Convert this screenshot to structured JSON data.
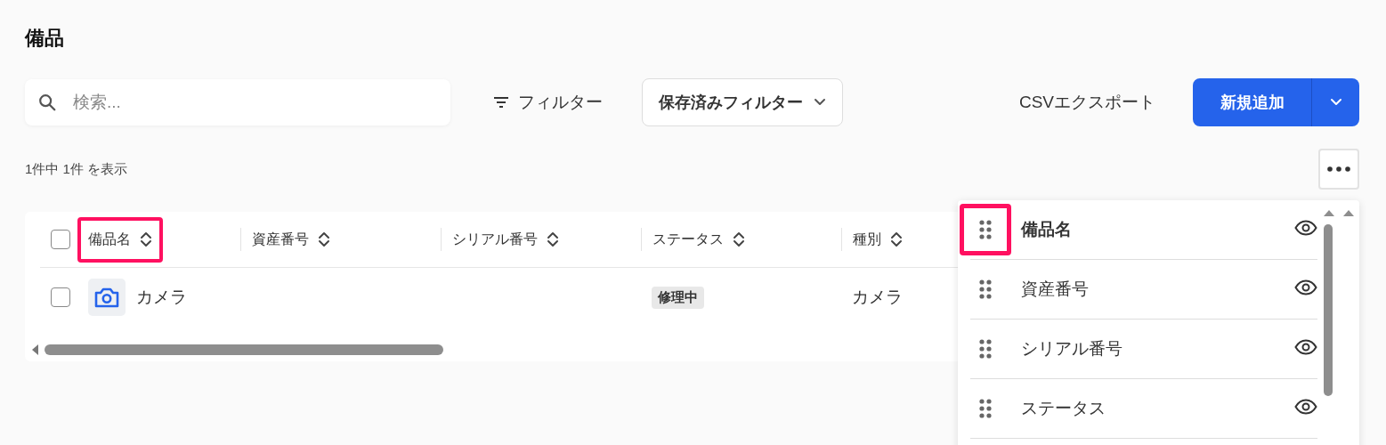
{
  "page": {
    "title": "備品"
  },
  "toolbar": {
    "search": {
      "placeholder": "検索..."
    },
    "filter_button": "フィルター",
    "saved_filters": "保存済みフィルター",
    "export_button": "CSVエクスポート",
    "add_button": "新規追加"
  },
  "result_count": "1件中 1件 を表示",
  "table": {
    "all_selected": false,
    "columns": [
      {
        "label": "備品名",
        "highlighted": true
      },
      {
        "label": "資産番号",
        "highlighted": false
      },
      {
        "label": "シリアル番号",
        "highlighted": false
      },
      {
        "label": "ステータス",
        "highlighted": false
      },
      {
        "label": "種別",
        "highlighted": false
      }
    ],
    "rows": [
      {
        "selected": false,
        "name": "カメラ",
        "status": "修理中",
        "category": "カメラ"
      }
    ]
  },
  "column_panel": {
    "items": [
      {
        "label": "備品名",
        "primary": true,
        "highlighted": true,
        "visible": true
      },
      {
        "label": "資産番号",
        "primary": false,
        "highlighted": false,
        "visible": true
      },
      {
        "label": "シリアル番号",
        "primary": false,
        "highlighted": false,
        "visible": true
      },
      {
        "label": "ステータス",
        "primary": false,
        "highlighted": false,
        "visible": true
      }
    ]
  }
}
